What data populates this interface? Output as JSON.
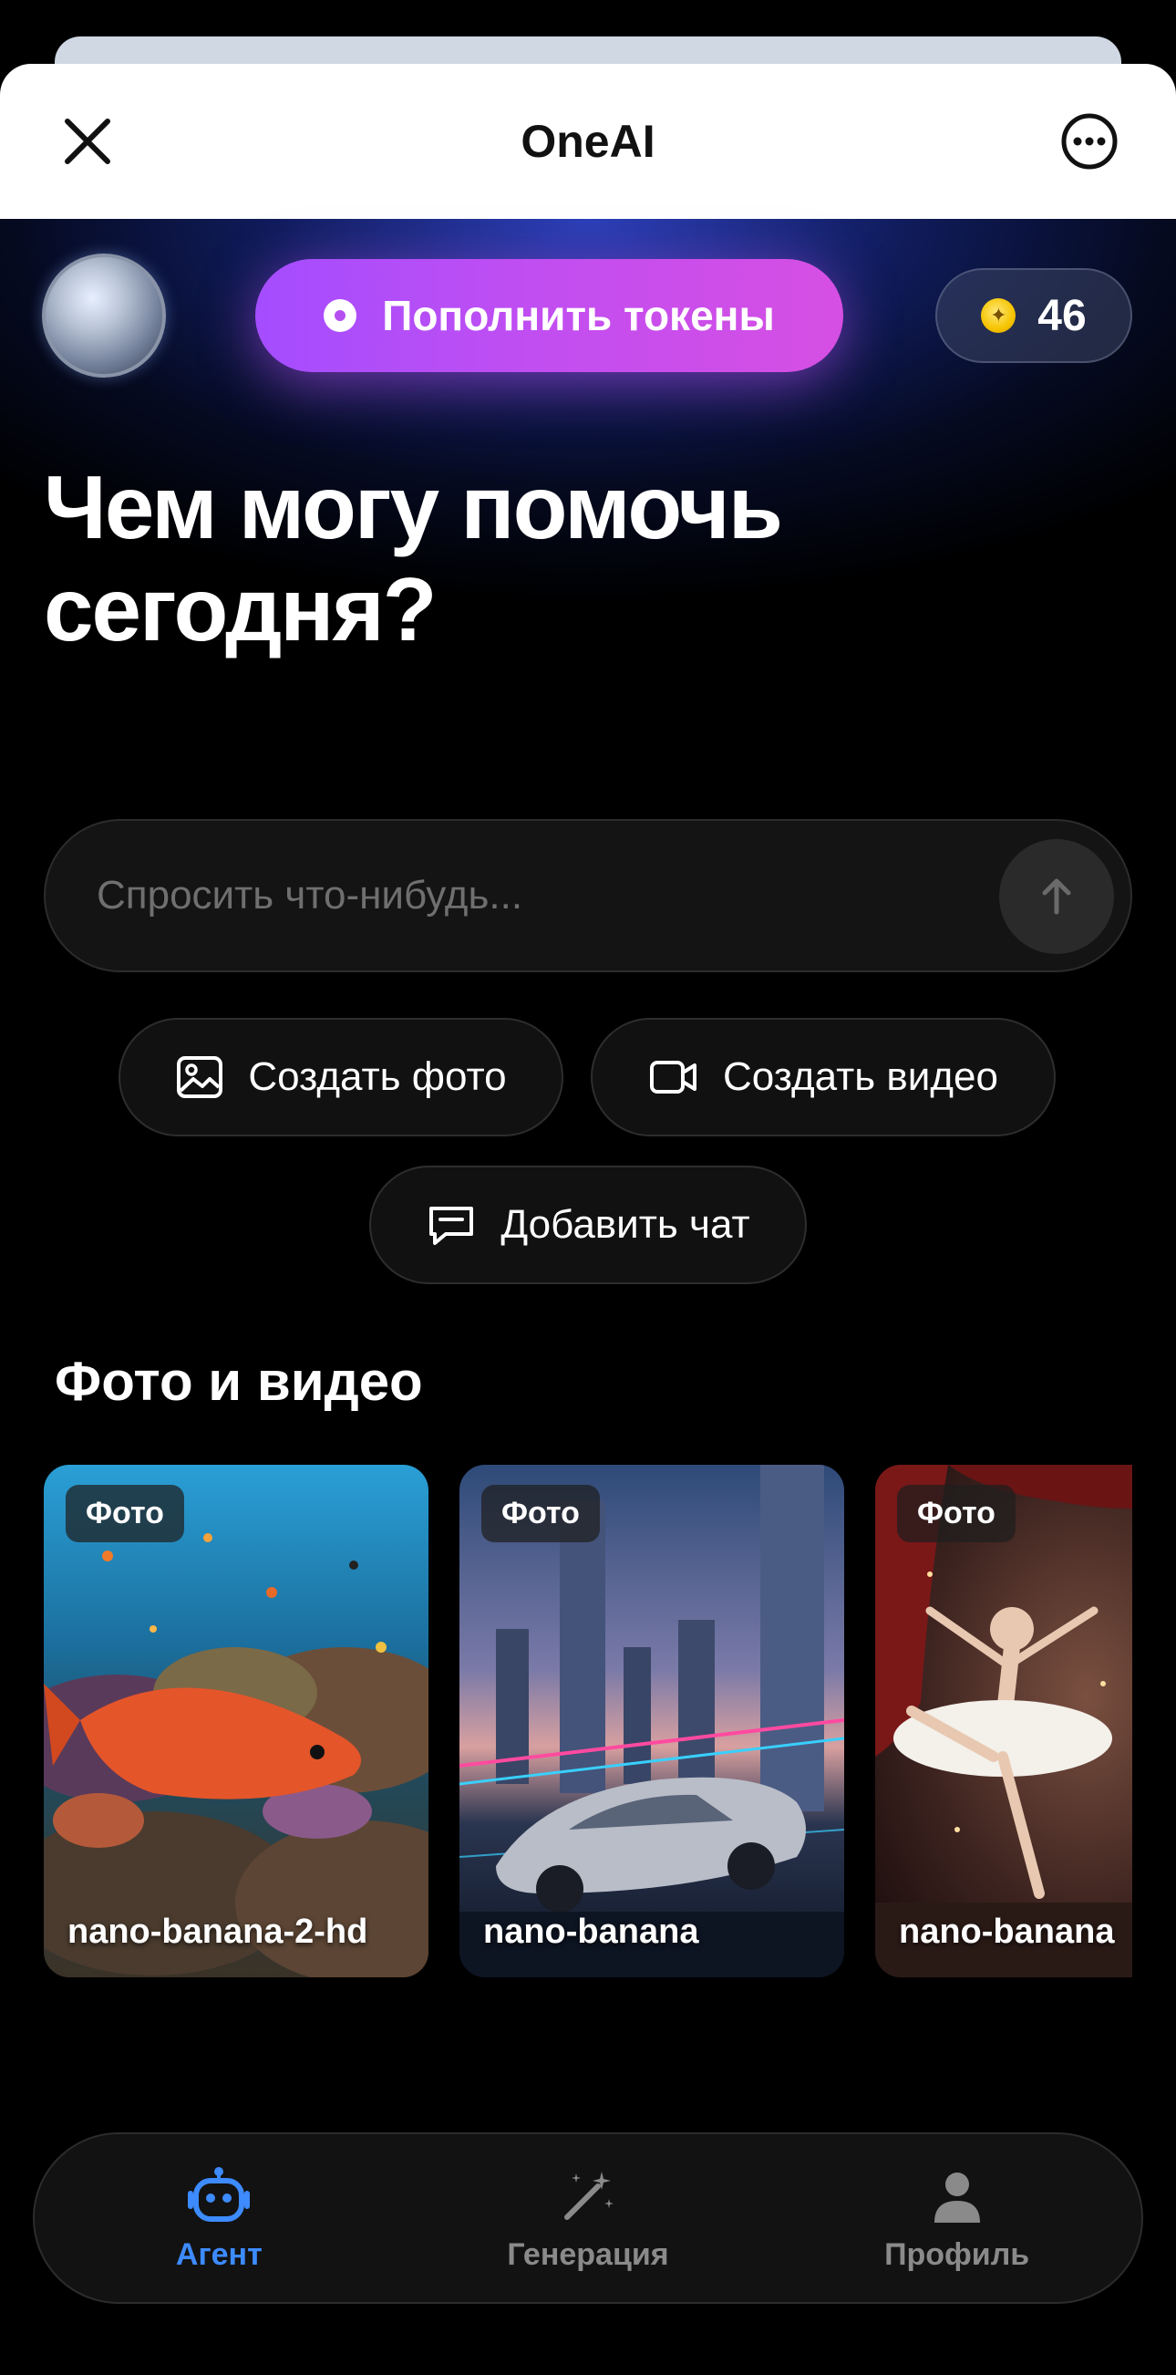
{
  "header": {
    "title": "OneAI"
  },
  "hero": {
    "topup_label": "Пополнить токены",
    "token_count": "46",
    "headline_line1": "Чем могу помочь",
    "headline_line2": "сегодня?"
  },
  "ask": {
    "placeholder": "Спросить что-нибудь..."
  },
  "actions": {
    "create_photo": "Создать фото",
    "create_video": "Создать видео",
    "add_chat": "Добавить чат"
  },
  "media": {
    "section_title": "Фото и видео",
    "cards": [
      {
        "badge": "Фото",
        "model": "nano-banana-2-hd"
      },
      {
        "badge": "Фото",
        "model": "nano-banana"
      },
      {
        "badge": "Фото",
        "model": "nano-banana"
      }
    ]
  },
  "tabbar": {
    "items": [
      {
        "label": "Агент",
        "icon": "robot-icon",
        "active": true
      },
      {
        "label": "Генерация",
        "icon": "magic-wand-icon",
        "active": false
      },
      {
        "label": "Профиль",
        "icon": "person-icon",
        "active": false
      }
    ]
  },
  "colors": {
    "accent_blue": "#3d8bff",
    "topup_gradient_start": "#a44dff",
    "topup_gradient_end": "#d64fe3",
    "coin": "#f5c400"
  }
}
